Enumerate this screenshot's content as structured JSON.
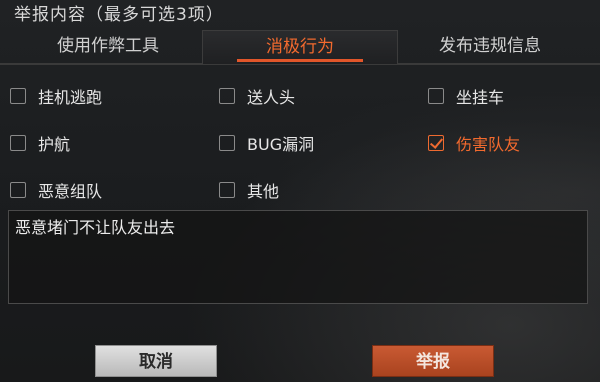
{
  "header": {
    "title": "举报内容（最多可选3项）"
  },
  "tabs": [
    {
      "label": "使用作弊工具",
      "active": false
    },
    {
      "label": "消极行为",
      "active": true
    },
    {
      "label": "发布违规信息",
      "active": false
    }
  ],
  "options": [
    {
      "label": "挂机逃跑",
      "checked": false
    },
    {
      "label": "送人头",
      "checked": false
    },
    {
      "label": "坐挂车",
      "checked": false
    },
    {
      "label": "护航",
      "checked": false
    },
    {
      "label": "BUG漏洞",
      "checked": false
    },
    {
      "label": "伤害队友",
      "checked": true
    },
    {
      "label": "恶意组队",
      "checked": false
    },
    {
      "label": "其他",
      "checked": false
    }
  ],
  "description": {
    "value": "恶意堵门不让队友出去"
  },
  "buttons": {
    "cancel": "取消",
    "report": "举报"
  },
  "colors": {
    "accent": "#f26a2e",
    "background": "#1b1d1f"
  }
}
